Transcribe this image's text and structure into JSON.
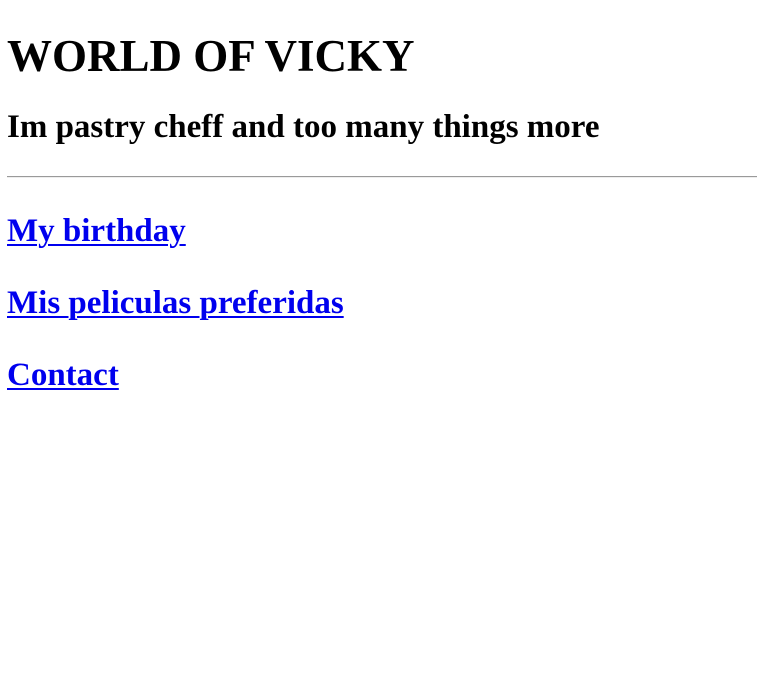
{
  "page": {
    "title": "WORLD OF VICKY",
    "subtitle": "Im pastry cheff and too many things more"
  },
  "nav": {
    "links": [
      {
        "label": "My birthday"
      },
      {
        "label": "Mis peliculas preferidas"
      },
      {
        "label": "Contact"
      }
    ],
    "link_color": "#0000ee"
  }
}
